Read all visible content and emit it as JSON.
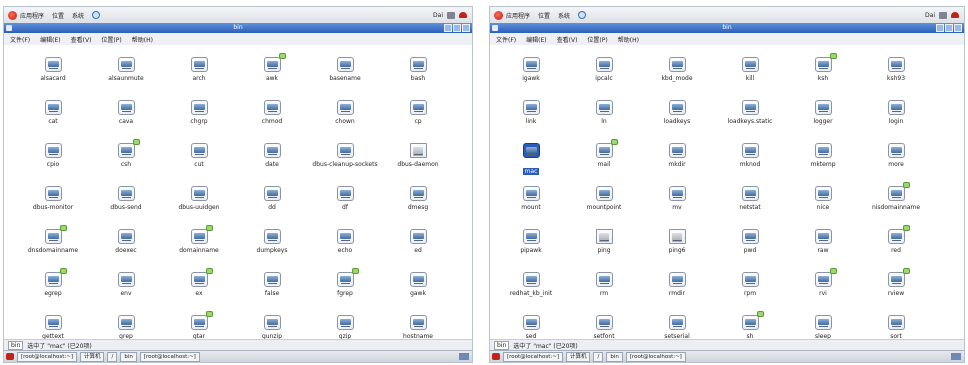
{
  "left": {
    "menu": [
      "应用程序",
      "位置",
      "系统"
    ],
    "clock": "Dai",
    "window_title": "bin",
    "menubar": [
      "文件(F)",
      "编辑(E)",
      "查看(V)",
      "位置(P)",
      "帮助(H)"
    ],
    "status": {
      "location": "bin",
      "text": "选中了 \"mac\" (已20项)"
    },
    "taskbar": [
      "[root@localhost:~]",
      "计算机",
      "/",
      "bin",
      "[root@localhost:~]"
    ],
    "files": [
      {
        "label": "alsacard",
        "badge": false
      },
      {
        "label": "alsaunmute",
        "badge": false
      },
      {
        "label": "arch",
        "badge": false
      },
      {
        "label": "awk",
        "badge": true
      },
      {
        "label": "basename",
        "badge": false
      },
      {
        "label": "bash",
        "badge": false
      },
      {
        "label": "cat",
        "badge": false
      },
      {
        "label": "cava",
        "badge": false
      },
      {
        "label": "chgrp",
        "badge": false
      },
      {
        "label": "chmod",
        "badge": false
      },
      {
        "label": "chown",
        "badge": false
      },
      {
        "label": "cp",
        "badge": false
      },
      {
        "label": "cpio",
        "badge": false
      },
      {
        "label": "csh",
        "badge": true
      },
      {
        "label": "cut",
        "badge": false
      },
      {
        "label": "date",
        "badge": false
      },
      {
        "label": "dbus-cleanup-sockets",
        "badge": false
      },
      {
        "label": "dbus-daemon",
        "badge": false,
        "doc": true
      },
      {
        "label": "dbus-monitor",
        "badge": false
      },
      {
        "label": "dbus-send",
        "badge": false
      },
      {
        "label": "dbus-uuidgen",
        "badge": false
      },
      {
        "label": "dd",
        "badge": false
      },
      {
        "label": "df",
        "badge": false
      },
      {
        "label": "dmesg",
        "badge": false
      },
      {
        "label": "dnsdomainname",
        "badge": true
      },
      {
        "label": "doexec",
        "badge": false
      },
      {
        "label": "domainname",
        "badge": true
      },
      {
        "label": "dumpkeys",
        "badge": false
      },
      {
        "label": "echo",
        "badge": false
      },
      {
        "label": "ed",
        "badge": false
      },
      {
        "label": "egrep",
        "badge": true
      },
      {
        "label": "env",
        "badge": false
      },
      {
        "label": "ex",
        "badge": true
      },
      {
        "label": "false",
        "badge": false
      },
      {
        "label": "fgrep",
        "badge": true
      },
      {
        "label": "gawk",
        "badge": false
      },
      {
        "label": "gettext",
        "badge": false
      },
      {
        "label": "grep",
        "badge": false
      },
      {
        "label": "gtar",
        "badge": true
      },
      {
        "label": "gunzip",
        "badge": false
      },
      {
        "label": "gzip",
        "badge": false
      },
      {
        "label": "hostname",
        "badge": false
      }
    ]
  },
  "right": {
    "menu": [
      "应用程序",
      "位置",
      "系统"
    ],
    "clock": "Dai",
    "window_title": "bin",
    "menubar": [
      "文件(F)",
      "编辑(E)",
      "查看(V)",
      "位置(P)",
      "帮助(H)"
    ],
    "status": {
      "location": "bin",
      "text": "选中了 \"mac\" (已20项)"
    },
    "taskbar": [
      "[root@localhost:~]",
      "计算机",
      "/",
      "bin",
      "[root@localhost:~]"
    ],
    "files": [
      {
        "label": "igawk",
        "badge": false
      },
      {
        "label": "ipcalc",
        "badge": false
      },
      {
        "label": "kbd_mode",
        "badge": false
      },
      {
        "label": "kill",
        "badge": false
      },
      {
        "label": "ksh",
        "badge": true
      },
      {
        "label": "ksh93",
        "badge": false
      },
      {
        "label": "link",
        "badge": false
      },
      {
        "label": "ln",
        "badge": false
      },
      {
        "label": "loadkeys",
        "badge": false
      },
      {
        "label": "loadkeys.static",
        "badge": false
      },
      {
        "label": "logger",
        "badge": false
      },
      {
        "label": "login",
        "badge": false
      },
      {
        "label": "mac",
        "badge": false,
        "selected": true
      },
      {
        "label": "mail",
        "badge": true
      },
      {
        "label": "mkdir",
        "badge": false
      },
      {
        "label": "mknod",
        "badge": false
      },
      {
        "label": "mktemp",
        "badge": false
      },
      {
        "label": "more",
        "badge": false
      },
      {
        "label": "mount",
        "badge": false
      },
      {
        "label": "mountpoint",
        "badge": false
      },
      {
        "label": "mv",
        "badge": false
      },
      {
        "label": "netstat",
        "badge": false
      },
      {
        "label": "nice",
        "badge": false
      },
      {
        "label": "nisdomainname",
        "badge": true
      },
      {
        "label": "pipawk",
        "badge": false
      },
      {
        "label": "ping",
        "badge": false,
        "doc": true
      },
      {
        "label": "ping6",
        "badge": false,
        "doc": true
      },
      {
        "label": "pwd",
        "badge": false
      },
      {
        "label": "raw",
        "badge": false
      },
      {
        "label": "red",
        "badge": true
      },
      {
        "label": "redhat_kb_init",
        "badge": false
      },
      {
        "label": "rm",
        "badge": false
      },
      {
        "label": "rmdir",
        "badge": false
      },
      {
        "label": "rpm",
        "badge": false
      },
      {
        "label": "rvi",
        "badge": true
      },
      {
        "label": "rview",
        "badge": true
      },
      {
        "label": "sed",
        "badge": false
      },
      {
        "label": "setfont",
        "badge": false
      },
      {
        "label": "setserial",
        "badge": false
      },
      {
        "label": "sh",
        "badge": true
      },
      {
        "label": "sleep",
        "badge": false
      },
      {
        "label": "sort",
        "badge": false
      }
    ]
  }
}
